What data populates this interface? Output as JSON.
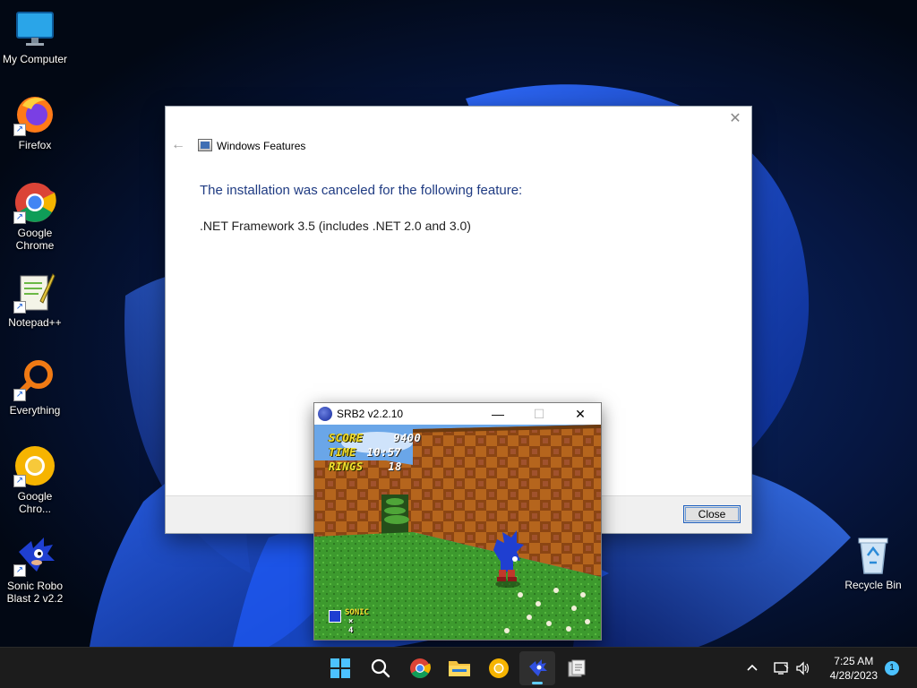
{
  "desktop": {
    "icons": [
      {
        "label": "My Computer",
        "icon": "monitor-icon"
      },
      {
        "label": "Firefox",
        "icon": "firefox-icon"
      },
      {
        "label": "Google Chrome",
        "icon": "chrome-icon"
      },
      {
        "label": "Notepad++",
        "icon": "notepadpp-icon"
      },
      {
        "label": "Everything",
        "icon": "everything-search-icon"
      },
      {
        "label": "Google Chro...",
        "icon": "chrome-canary-icon"
      },
      {
        "label": "Sonic Robo Blast 2 v2.2",
        "icon": "sonic-icon"
      }
    ],
    "recycle_bin": {
      "label": "Recycle Bin",
      "icon": "recycle-bin-icon"
    }
  },
  "dialog": {
    "title": "Windows Features",
    "heading": "The installation was canceled for the following feature:",
    "feature": ".NET Framework 3.5 (includes .NET 2.0 and 3.0)",
    "close_button": "Close",
    "close_glyph": "✕",
    "back_glyph": "←"
  },
  "game_window": {
    "title": "SRB2 v2.2.10",
    "minimize_glyph": "—",
    "maximize_glyph": "☐",
    "close_glyph": "✕",
    "hud": {
      "score_label": "SCORE",
      "score_value": "9400",
      "time_label": "TIME",
      "time_value": "10:57",
      "rings_label": "RINGS",
      "rings_value": "18",
      "character": "SONIC",
      "lives": "× 4"
    }
  },
  "taskbar": {
    "time": "7:25 AM",
    "date": "4/28/2023",
    "notification_count": "1",
    "pinned": [
      "start-icon",
      "search-icon",
      "chrome-icon",
      "file-explorer-icon",
      "chrome-canary-icon",
      "sonic-icon",
      "app-icon"
    ],
    "accent": "#60cdff"
  }
}
